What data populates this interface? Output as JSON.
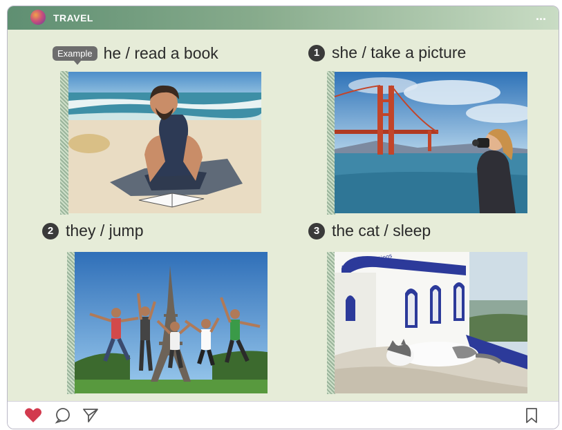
{
  "header": {
    "title": "TRAVEL",
    "more": "..."
  },
  "example": {
    "badge": "Example",
    "title": "he / read a book"
  },
  "items": [
    {
      "num": "1",
      "title": "she / take a picture"
    },
    {
      "num": "2",
      "title": "they / jump"
    },
    {
      "num": "3",
      "title": "the cat / sleep"
    }
  ],
  "church_sign": "Agios Konstantinos",
  "colors": {
    "header_start": "#5f8f72",
    "content_bg": "#e6ecd8",
    "like": "#d23a4e"
  },
  "icons": [
    "heart-icon",
    "comment-icon",
    "send-icon",
    "bookmark-icon"
  ]
}
